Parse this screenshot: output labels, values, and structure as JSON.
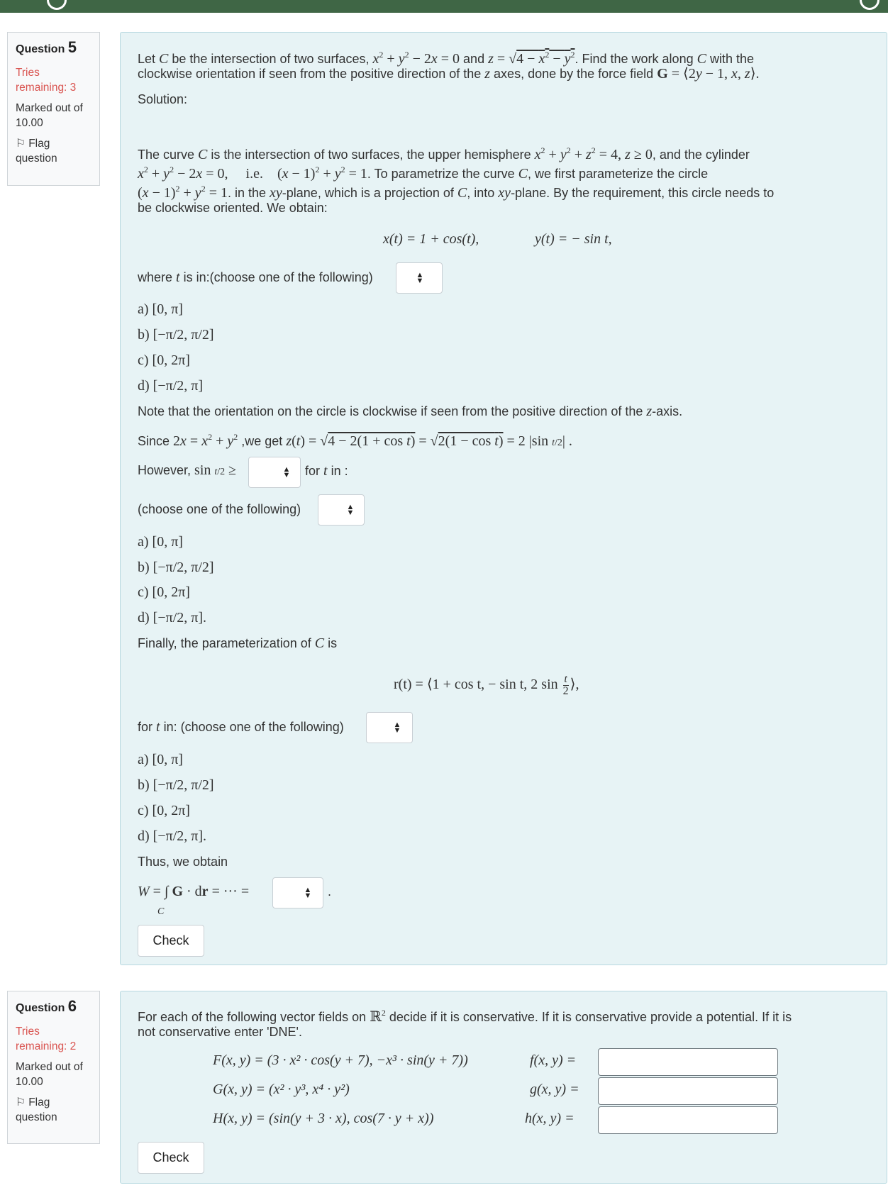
{
  "q5": {
    "info": {
      "question_label": "Question",
      "number": "5",
      "tries": "Tries remaining: 3",
      "marked": "Marked out of 10.00",
      "flag": "Flag question"
    },
    "intro_1a": "Let ",
    "intro_1b": " be the intersection of two surfaces, ",
    "intro_1c": " and ",
    "intro_1d": ". Find the work along ",
    "intro_1e": " with the",
    "intro_2a": "clockwise orientation if seen from the positive direction of the ",
    "intro_2b": " axes, done by the force field ",
    "solution": "Solution:",
    "p1_1a": "The curve ",
    "p1_1b": " is the intersection of two surfaces, the upper hemisphere ",
    "p1_1c": ", and the  cylinder",
    "p1_2a": ". To parametrize  the curve ",
    "p1_2b": ", we first parameterize the circle",
    "p1_3a": ". in the ",
    "p1_3b": "-plane, which is a projection of ",
    "p1_3c": ", into ",
    "p1_3d": "-plane. By the requirement,  this circle needs to",
    "p1_4": "be clockwise oriented. We obtain:",
    "eq_x": "x(t) = 1 + cos(t),",
    "eq_y": "y(t) = − sin t,",
    "where_a": "where ",
    "where_b": " is in:(choose one of the following)",
    "options": [
      "a) [0, π]",
      "b) [−π/2, π/2]",
      "c) [0, 2π]",
      "d) [−π/2, π]"
    ],
    "options_dot": [
      "a) [0, π]",
      "b) [−π/2, π/2]",
      "c) [0, 2π]",
      "d) [−π/2, π]."
    ],
    "note_a": "Note that the orientation on the circle is clockwise if seen from the positive direction of the ",
    "note_b": "-axis.",
    "since_a": "Since ",
    "since_b": " ,we get ",
    "however_a": "However, ",
    "however_b": " for ",
    "however_c": " in :",
    "choose": "(choose one of the following)",
    "finally_a": "Finally, the parameterization of ",
    "finally_b": " is",
    "rt": "r(t) = ⟨1 + cos t, − sin t, 2 sin",
    "fort_a": "for ",
    "fort_b": " in: (choose one of the following)",
    "thus": "Thus, we obtain",
    "check": "Check"
  },
  "q6": {
    "info": {
      "question_label": "Question",
      "number": "6",
      "tries": "Tries remaining: 2",
      "marked": "Marked out of 10.00",
      "flag": "Flag question"
    },
    "intro_1a": "For each of the following vector fields on ",
    "intro_1b": " decide if it is conservative. If it is conservative provide a potential. If it is",
    "intro_2": "not conservative enter 'DNE'.",
    "fields": [
      {
        "field": "F(x, y) = (3 · x² · cos(y + 7), −x³ · sin(y + 7))",
        "potential": "f(x, y) ="
      },
      {
        "field": "G(x, y) = (x² · y³, x⁴ · y²)",
        "potential": "g(x, y) ="
      },
      {
        "field": "H(x, y) = (sin(y + 3 · x), cos(7 · y + x))",
        "potential": "h(x, y) ="
      }
    ],
    "check": "Check"
  }
}
